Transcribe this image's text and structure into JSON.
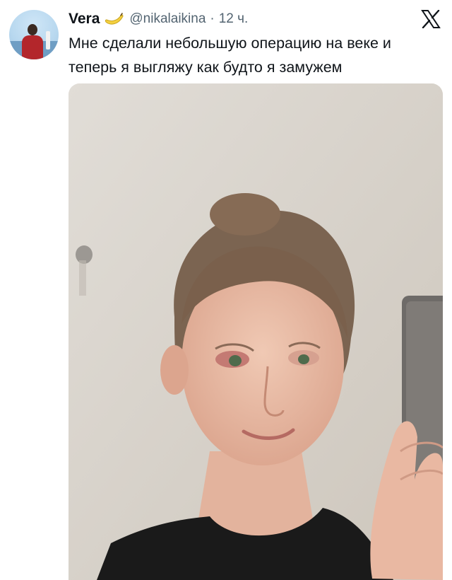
{
  "tweet": {
    "author_name": "Vera",
    "handle": "@nikalaikina",
    "separator": "·",
    "time": "12 ч.",
    "text_lines": [
      "Мне сделали небольшую операцию на веке и",
      "теперь я выгляжу как будто я замужем"
    ],
    "verified_badge_icon": "banana-badge-icon",
    "brand_icon": "x-logo-icon",
    "media_icon": "mirror-selfie-photo"
  },
  "colors": {
    "text_primary": "#0f1419",
    "text_secondary": "#536471",
    "badge": "#f4d03f"
  }
}
